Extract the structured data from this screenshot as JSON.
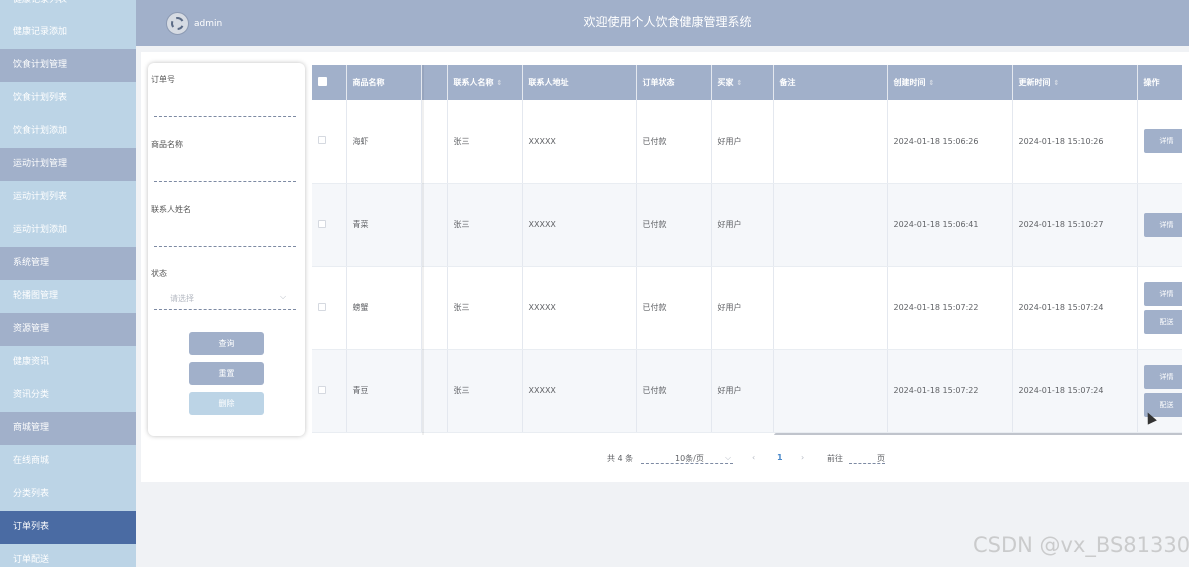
{
  "sidebar": {
    "items": [
      {
        "label": "健康记录列表",
        "kind": "sub"
      },
      {
        "label": "健康记录添加",
        "kind": "sub"
      },
      {
        "label": "饮食计划管理",
        "kind": "group"
      },
      {
        "label": "饮食计划列表",
        "kind": "sub"
      },
      {
        "label": "饮食计划添加",
        "kind": "sub"
      },
      {
        "label": "运动计划管理",
        "kind": "group"
      },
      {
        "label": "运动计划列表",
        "kind": "sub"
      },
      {
        "label": "运动计划添加",
        "kind": "sub"
      },
      {
        "label": "系统管理",
        "kind": "group"
      },
      {
        "label": "轮播图管理",
        "kind": "sub"
      },
      {
        "label": "资源管理",
        "kind": "group"
      },
      {
        "label": "健康资讯",
        "kind": "sub"
      },
      {
        "label": "资讯分类",
        "kind": "sub"
      },
      {
        "label": "商城管理",
        "kind": "group"
      },
      {
        "label": "在线商城",
        "kind": "sub"
      },
      {
        "label": "分类列表",
        "kind": "sub"
      },
      {
        "label": "订单列表",
        "kind": "active"
      },
      {
        "label": "订单配送",
        "kind": "sub"
      }
    ]
  },
  "header": {
    "username": "admin",
    "title": "欢迎使用个人饮食健康管理系统"
  },
  "search": {
    "order_no_label": "订单号",
    "product_name_label": "商品名称",
    "contact_name_label": "联系人姓名",
    "status_label": "状态",
    "status_placeholder": "请选择",
    "query_button": "查询",
    "reset_button": "重置",
    "delete_button": "删除"
  },
  "table": {
    "columns": [
      "商品名称",
      "联系人名称",
      "联系人地址",
      "订单状态",
      "买家",
      "备注",
      "创建时间",
      "更新时间",
      "操作"
    ],
    "rows": [
      {
        "product": "海虾",
        "contact": "张三",
        "address": "XXXXX",
        "status": "已付款",
        "buyer": "好用户",
        "remark": "",
        "created": "2024-01-18 15:06:26",
        "updated": "2024-01-18 15:10:26",
        "actions": [
          "详情"
        ]
      },
      {
        "product": "青菜",
        "contact": "张三",
        "address": "XXXXX",
        "status": "已付款",
        "buyer": "好用户",
        "remark": "",
        "created": "2024-01-18 15:06:41",
        "updated": "2024-01-18 15:10:27",
        "actions": [
          "详情"
        ]
      },
      {
        "product": "螃蟹",
        "contact": "张三",
        "address": "XXXXX",
        "status": "已付款",
        "buyer": "好用户",
        "remark": "",
        "created": "2024-01-18 15:07:22",
        "updated": "2024-01-18 15:07:24",
        "actions": [
          "详情",
          "配送"
        ]
      },
      {
        "product": "青豆",
        "contact": "张三",
        "address": "XXXXX",
        "status": "已付款",
        "buyer": "好用户",
        "remark": "",
        "created": "2024-01-18 15:07:22",
        "updated": "2024-01-18 15:07:24",
        "actions": [
          "详情",
          "配送"
        ]
      }
    ]
  },
  "pagination": {
    "total": "共 4 条",
    "page_size": "10条/页",
    "prev": "‹",
    "current": "1",
    "next": "›",
    "goto": "前往",
    "page_unit": "页"
  },
  "watermark": "CSDN @vx_BS81330",
  "colors": {
    "sidebar_bg": "#b9d3e5",
    "group_bg": "#a1b0ca",
    "active_bg": "#4a6ba3",
    "header_bg": "#a1b0ca",
    "page_link": "#4a88c9"
  }
}
